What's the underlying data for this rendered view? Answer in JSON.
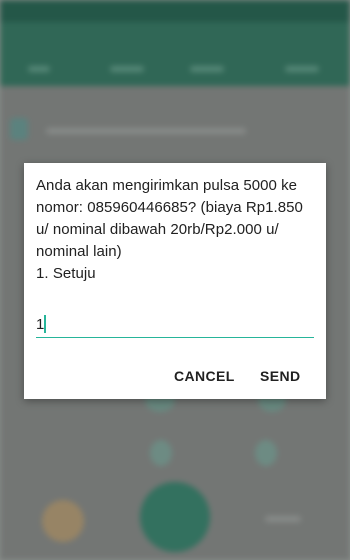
{
  "dialog": {
    "message": "Anda akan mengirimkan pulsa 5000 ke\nnomor: 085960446685? (biaya Rp1.850\nu/ nominal dibawah 20rb/Rp2.000 u/\nnominal lain)\n1. Setuju",
    "input_value": "1",
    "cancel_label": "CANCEL",
    "send_label": "SEND"
  },
  "colors": {
    "accent": "#26b59a",
    "app_bar": "#3b7e69"
  }
}
